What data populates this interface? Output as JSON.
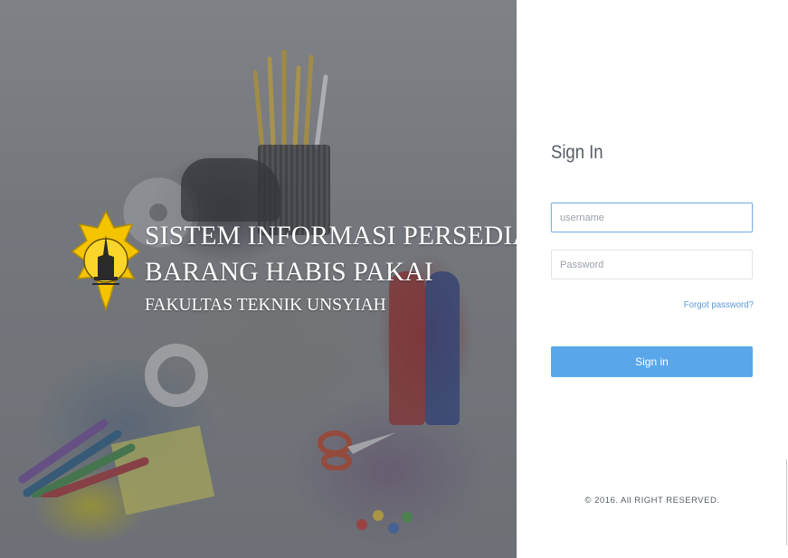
{
  "branding": {
    "line1": "SISTEM INFORMASI PERSEDIAAN",
    "line2": "BARANG HABIS PAKAI",
    "line3": "FAKULTAS TEKNIK UNSYIAH",
    "logo_icon": "university-crest-icon",
    "colors": {
      "crest_yellow": "#f5c400",
      "crest_dark": "#2a2a2a"
    }
  },
  "login": {
    "title": "Sign In",
    "username": {
      "value": "",
      "placeholder": "username"
    },
    "password": {
      "value": "",
      "placeholder": "Password"
    },
    "forgot_label": "Forgot password?",
    "submit_label": "Sign in",
    "footer": "© 2016. All RIGHT RESERVED."
  },
  "colors": {
    "accent": "#5aa6ea",
    "link": "#5c9ad6",
    "title_text": "#555b66"
  }
}
